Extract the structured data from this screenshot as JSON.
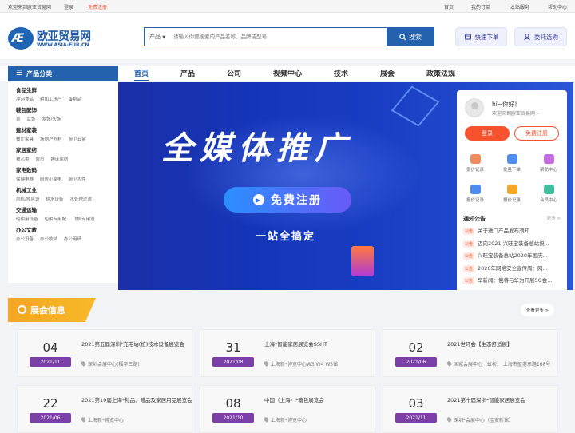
{
  "topbar": {
    "welcome": "欢迎来到欧亚贸易网",
    "login": "登录",
    "register": "免费注册",
    "links": [
      "首页",
      "我的订单",
      "本站服务",
      "帮助中心"
    ]
  },
  "logo": {
    "cn": "欧亚贸易网",
    "en": "WWW.ASIA-EUR.CN",
    "mark": "Æ"
  },
  "search": {
    "category": "产品",
    "placeholder": "请输入你要搜索的产品名称、品牌或型号",
    "button": "搜索"
  },
  "actions": {
    "quick_order": "快速下单",
    "consign": "委托选购"
  },
  "nav": {
    "category_title": "产品分类",
    "items": [
      "首页",
      "产品",
      "公司",
      "视频中心",
      "技术",
      "展会",
      "政策法规"
    ]
  },
  "categories": [
    {
      "title": "食品生鲜",
      "subs": [
        "冲泡食品",
        "粗加工水产",
        "蛋制品"
      ]
    },
    {
      "title": "鞋包配饰",
      "subs": [
        "表",
        "耳饰",
        "发饰/头饰"
      ]
    },
    {
      "title": "建材家装",
      "subs": [
        "餐厅家具",
        "场地户外材",
        "厨卫五金"
      ]
    },
    {
      "title": "家居家纺",
      "subs": [
        "被芯类",
        "窗帘",
        "睡床家纺"
      ]
    },
    {
      "title": "家电数码",
      "subs": [
        "保健电器",
        "厨房小家电",
        "厨卫大件"
      ]
    },
    {
      "title": "机械工业",
      "subs": [
        "风机/排风设",
        "给水设备",
        "水处理过滤"
      ]
    },
    {
      "title": "交通运输",
      "subs": [
        "船舶用设备",
        "船舶专用配",
        "飞机专用设"
      ]
    },
    {
      "title": "办公文教",
      "subs": [
        "办公设备",
        "办公收纳",
        "办公用纸"
      ]
    }
  ],
  "banner": {
    "title": "全媒体推广",
    "button": "免费注册",
    "subtitle": "一站全搞定"
  },
  "user": {
    "greeting": "hi~你好！",
    "welcome": "欢迎来到欧亚贸易网~",
    "login": "登录",
    "register": "免费注册",
    "quick": [
      {
        "label": "报价记录",
        "color": "#f08a5d"
      },
      {
        "label": "批量下单",
        "color": "#4a8cf0"
      },
      {
        "label": "帮助中心",
        "color": "#c56be0"
      },
      {
        "label": "报价记录",
        "color": "#4a8cf0"
      },
      {
        "label": "报价记录",
        "color": "#f5a623"
      },
      {
        "label": "会员中心",
        "color": "#3fbfa0"
      }
    ],
    "notice_title": "通知公告",
    "notice_more": "更多 >",
    "notice_tag": "公告",
    "notices": [
      "关于进口产品发布须知",
      "迈向2021 兴旺宝装备总站祝...",
      "兴旺宝装备总站2020年国庆...",
      "2020年网络安全宣传周：网...",
      "早新闻：俄将与华为开展5G会..."
    ]
  },
  "expo": {
    "title": "展会信息",
    "more": "查看更多 >",
    "cards": [
      {
        "day": "04",
        "ym": "2021/11",
        "name": "2021第五届深圳*充电站(桩)技术设备展览会",
        "loc": "深圳会展中心(福华三路)"
      },
      {
        "day": "31",
        "ym": "2021/08",
        "name": "上海*智能家居展览会SSHT",
        "loc": "上海新*博览中心W3 W4 W5馆"
      },
      {
        "day": "02",
        "ym": "2021/06",
        "name": "2021世环会【生态舒适展】",
        "loc": "国家会展中心（虹桥） 上海市盈港东路168号"
      },
      {
        "day": "22",
        "ym": "2021/06",
        "name": "2021第19届上海*礼品、赠品及家居用品展览会",
        "loc": "上海新*博览中心"
      },
      {
        "day": "08",
        "ym": "2021/10",
        "name": "中国（上海）*箱包展览会",
        "loc": "上海新*博览中心"
      },
      {
        "day": "03",
        "ym": "2021/11",
        "name": "2021第十届深圳*智能家居展览会",
        "loc": "深圳*会展中心（宝安新馆）"
      }
    ]
  },
  "colors": {
    "brand": "#2462ad",
    "accent": "#f5522d",
    "expo": "#f5a623",
    "date_badge": "#7b3fa8"
  }
}
